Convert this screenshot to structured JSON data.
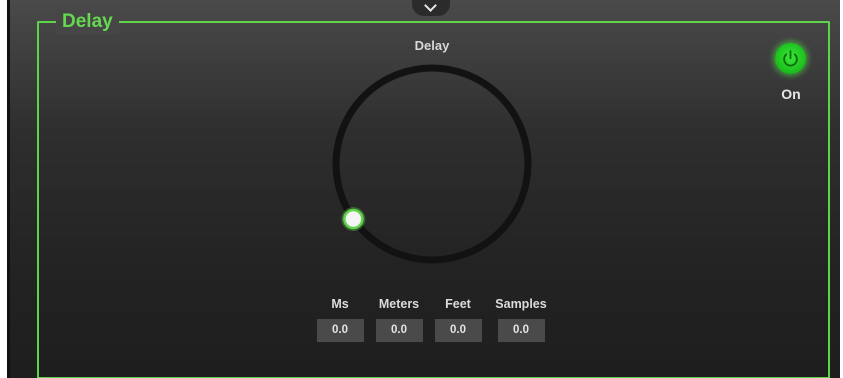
{
  "group": {
    "title": "Delay",
    "accent_color": "#5fd34a"
  },
  "collapse_toggle": {
    "icon": "chevron-down-icon"
  },
  "knob": {
    "label": "Delay",
    "value_fraction": 0.0,
    "indicator_color": "#5fd34a"
  },
  "power": {
    "label": "On",
    "state": "on",
    "icon": "power-icon",
    "color": "#1ec41e"
  },
  "units": [
    {
      "label": "Ms",
      "value": "0.0"
    },
    {
      "label": "Meters",
      "value": "0.0"
    },
    {
      "label": "Feet",
      "value": "0.0"
    },
    {
      "label": "Samples",
      "value": "0.0"
    }
  ]
}
